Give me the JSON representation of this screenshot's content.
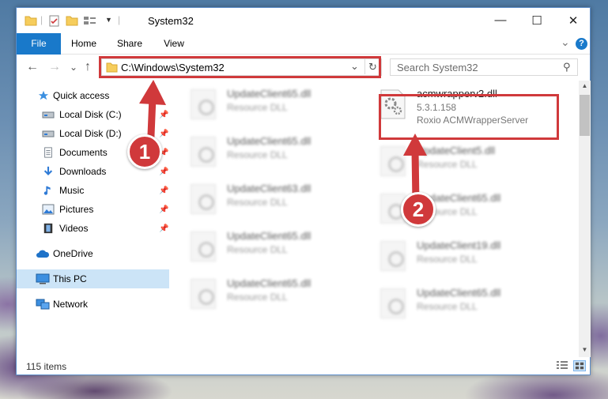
{
  "window": {
    "title": "System32",
    "minimize": "—",
    "maximize": "☐",
    "close": "✕"
  },
  "ribbon": {
    "tabs": [
      "File",
      "Home",
      "Share",
      "View"
    ],
    "expand": "⌄",
    "help": "?"
  },
  "nav": {
    "back": "←",
    "forward": "→",
    "recent": "⌄",
    "up": "↑"
  },
  "address": {
    "path": "C:\\Windows\\System32",
    "dropdown": "⌄",
    "refresh": "↻"
  },
  "search": {
    "placeholder": "Search System32",
    "icon": "⚲"
  },
  "sidebar": {
    "items": [
      {
        "label": "Quick access",
        "icon": "star-icon",
        "pinned": false
      },
      {
        "label": "Local Disk (C:)",
        "icon": "drive-icon",
        "pinned": true
      },
      {
        "label": "Local Disk (D:)",
        "icon": "drive-icon",
        "pinned": true
      },
      {
        "label": "Documents",
        "icon": "documents-icon",
        "pinned": true
      },
      {
        "label": "Downloads",
        "icon": "download-icon",
        "pinned": true
      },
      {
        "label": "Music",
        "icon": "music-icon",
        "pinned": true
      },
      {
        "label": "Pictures",
        "icon": "pictures-icon",
        "pinned": true
      },
      {
        "label": "Videos",
        "icon": "videos-icon",
        "pinned": true
      },
      {
        "label": "OneDrive",
        "icon": "onedrive-icon",
        "pinned": false
      },
      {
        "label": "This PC",
        "icon": "pc-icon",
        "pinned": false
      },
      {
        "label": "Network",
        "icon": "network-icon",
        "pinned": false
      }
    ],
    "pin_glyph": "📌"
  },
  "files": {
    "highlighted": {
      "name": "acmwrapperv2.dll",
      "version": "5.3.1.158",
      "company": "Roxio ACMWrapperServer"
    },
    "left_column": [
      {
        "name": "UpdateClient65.dll",
        "type": "Resource DLL"
      },
      {
        "name": "UpdateClient65.dll",
        "type": "Resource DLL"
      },
      {
        "name": "UpdateClient63.dll",
        "type": "Resource DLL"
      },
      {
        "name": "UpdateClient65.dll",
        "type": "Resource DLL"
      },
      {
        "name": "UpdateClient65.dll",
        "type": "Resource DLL"
      }
    ],
    "right_column": [
      {
        "name": "UpdateClient5.dll",
        "type": "Resource DLL"
      },
      {
        "name": "UpdateClient65.dll",
        "type": "Resource DLL"
      },
      {
        "name": "UpdateClient19.dll",
        "type": "Resource DLL"
      },
      {
        "name": "UpdateClient65.dll",
        "type": "Resource DLL"
      }
    ]
  },
  "status": {
    "count": "115 items"
  },
  "callouts": {
    "one": "1",
    "two": "2"
  },
  "colors": {
    "accent": "#1979ca",
    "highlight": "#d0393b",
    "selected": "#cce4f7"
  }
}
